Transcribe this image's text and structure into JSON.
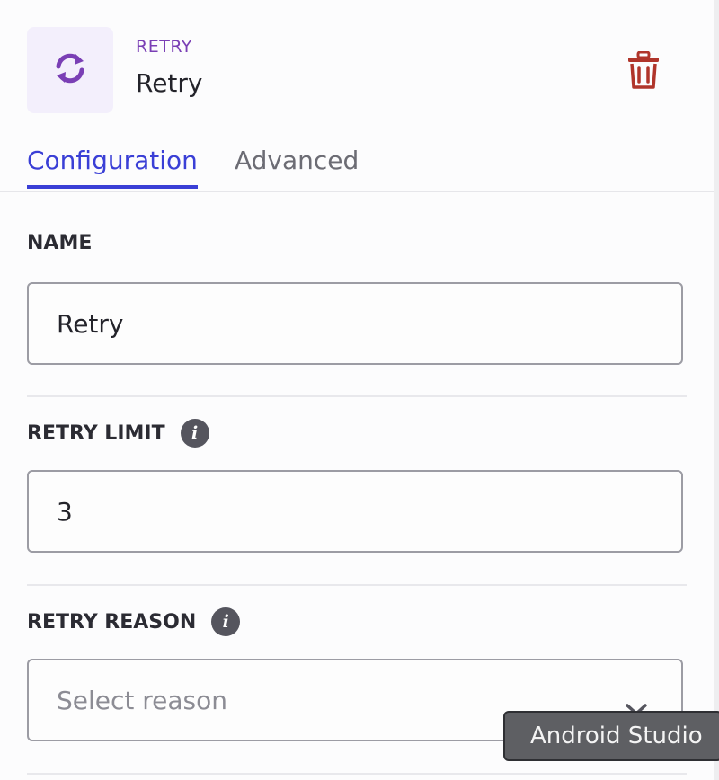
{
  "header": {
    "node_type": "RETRY",
    "node_name": "Retry",
    "icon": "refresh-icon",
    "delete_icon": "trash-icon"
  },
  "tabs": [
    {
      "label": "Configuration",
      "active": true
    },
    {
      "label": "Advanced",
      "active": false
    }
  ],
  "fields": {
    "name": {
      "label": "NAME",
      "value": "Retry"
    },
    "retry_limit": {
      "label": "RETRY LIMIT",
      "value": "3",
      "info_icon": "info-icon"
    },
    "retry_reason": {
      "label": "RETRY REASON",
      "placeholder": "Select reason",
      "info_icon": "info-icon",
      "dropdown_icon": "chevron-down-icon"
    }
  },
  "tooltip": {
    "text": "Android Studio"
  },
  "colors": {
    "accent": "#3a3fd6",
    "node_type": "#7a3fb5",
    "delete": "#b0352b",
    "icon_bg": "#f3effc"
  }
}
